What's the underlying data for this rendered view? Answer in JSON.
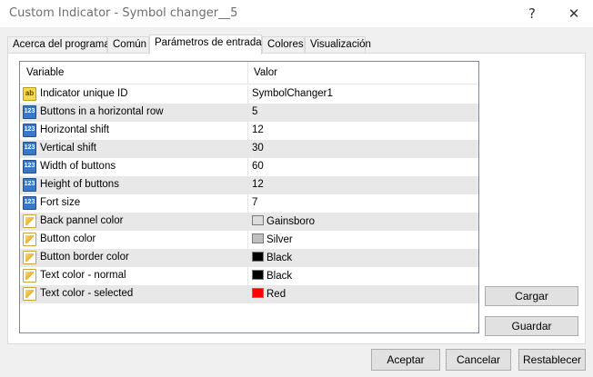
{
  "window": {
    "title": "Custom Indicator - Symbol changer__5",
    "help_glyph": "?",
    "close_glyph": "✕"
  },
  "tabs": [
    {
      "label": "Acerca del programa",
      "active": false
    },
    {
      "label": "Común",
      "active": false
    },
    {
      "label": "Parámetros de entrada",
      "active": true
    },
    {
      "label": "Colores",
      "active": false
    },
    {
      "label": "Visualización",
      "active": false
    }
  ],
  "grid": {
    "columns": {
      "variable": "Variable",
      "value": "Valor"
    },
    "rows": [
      {
        "icon": "text-param-icon",
        "icon_text": "ab",
        "name": "Indicator unique ID",
        "value": "SymbolChanger1"
      },
      {
        "icon": "integer-param-icon",
        "icon_text": "123",
        "name": "Buttons in a horizontal row",
        "value": "5"
      },
      {
        "icon": "integer-param-icon",
        "icon_text": "123",
        "name": "Horizontal shift",
        "value": "12"
      },
      {
        "icon": "integer-param-icon",
        "icon_text": "123",
        "name": "Vertical shift",
        "value": "30"
      },
      {
        "icon": "integer-param-icon",
        "icon_text": "123",
        "name": "Width of buttons",
        "value": "60"
      },
      {
        "icon": "integer-param-icon",
        "icon_text": "123",
        "name": "Height of buttons",
        "value": "12"
      },
      {
        "icon": "integer-param-icon",
        "icon_text": "123",
        "name": "Fort size",
        "value": "7"
      },
      {
        "icon": "color-param-icon",
        "name": "Back pannel color",
        "value": "Gainsboro",
        "swatch": "#dcdcdc"
      },
      {
        "icon": "color-param-icon",
        "name": "Button color",
        "value": "Silver",
        "swatch": "#c0c0c0"
      },
      {
        "icon": "color-param-icon",
        "name": "Button border color",
        "value": "Black",
        "swatch": "#000000"
      },
      {
        "icon": "color-param-icon",
        "name": "Text color - normal",
        "value": "Black",
        "swatch": "#000000"
      },
      {
        "icon": "color-param-icon",
        "name": "Text color - selected",
        "value": "Red",
        "swatch": "#ff0000"
      }
    ]
  },
  "side_buttons": {
    "load": "Cargar",
    "save": "Guardar"
  },
  "footer": {
    "accept": "Aceptar",
    "cancel": "Cancelar",
    "reset": "Restablecer"
  }
}
